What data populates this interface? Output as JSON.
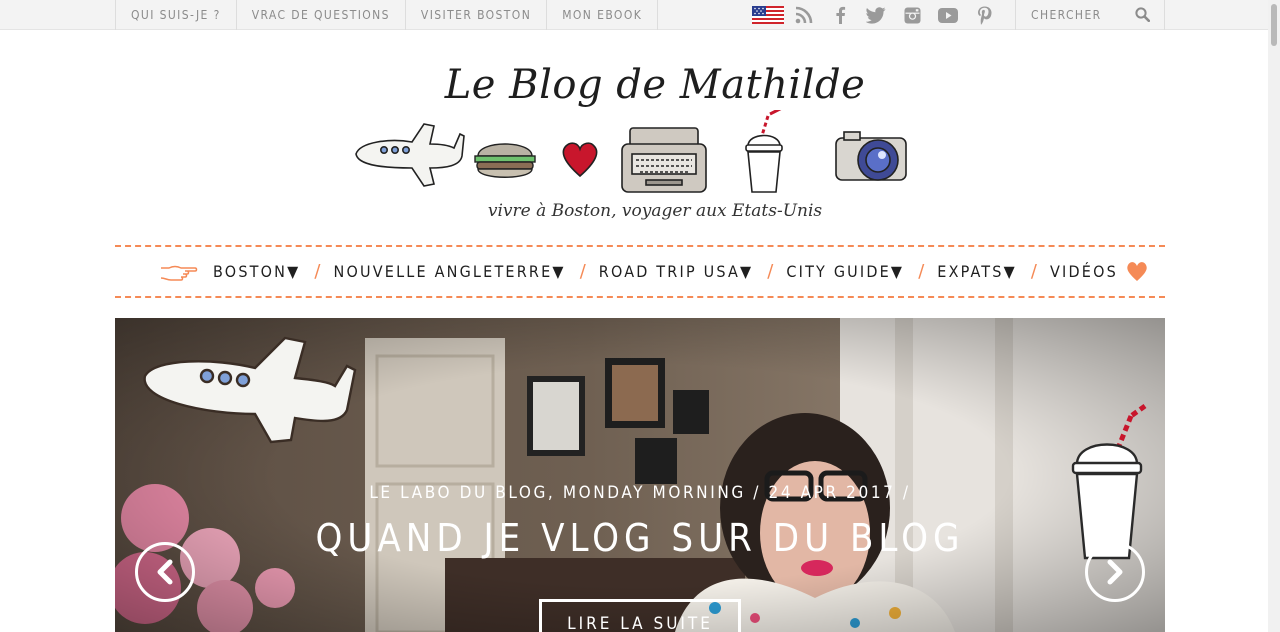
{
  "topnav": {
    "items": [
      {
        "label": "QUI SUIS-JE ?"
      },
      {
        "label": "VRAC DE QUESTIONS"
      },
      {
        "label": "VISITER BOSTON"
      },
      {
        "label": "MON EBOOK"
      }
    ]
  },
  "social": {
    "icons": [
      "us-flag-icon",
      "rss-icon",
      "facebook-icon",
      "twitter-icon",
      "instagram-icon",
      "youtube-icon",
      "pinterest-icon"
    ],
    "icon_color": "#9a9a9a"
  },
  "search": {
    "placeholder": "CHERCHER"
  },
  "header": {
    "title": "Le Blog de Mathilde",
    "tagline": "vivre à Boston, voyager aux Etats-Unis"
  },
  "mainnav": {
    "accent": "#f58a56",
    "items": [
      {
        "label": "BOSTON▼"
      },
      {
        "label": "NOUVELLE ANGLETERRE▼"
      },
      {
        "label": "ROAD TRIP USA▼"
      },
      {
        "label": "CITY GUIDE▼"
      },
      {
        "label": "EXPATS▼"
      },
      {
        "label": "VIDÉOS"
      }
    ],
    "separator": "/"
  },
  "hero": {
    "meta": "LE LABO DU BLOG, MONDAY MORNING / 24 APR 2017 /",
    "title": "QUAND JE VLOG SUR DU BLOG",
    "read_more": "LIRE LA SUITE"
  }
}
